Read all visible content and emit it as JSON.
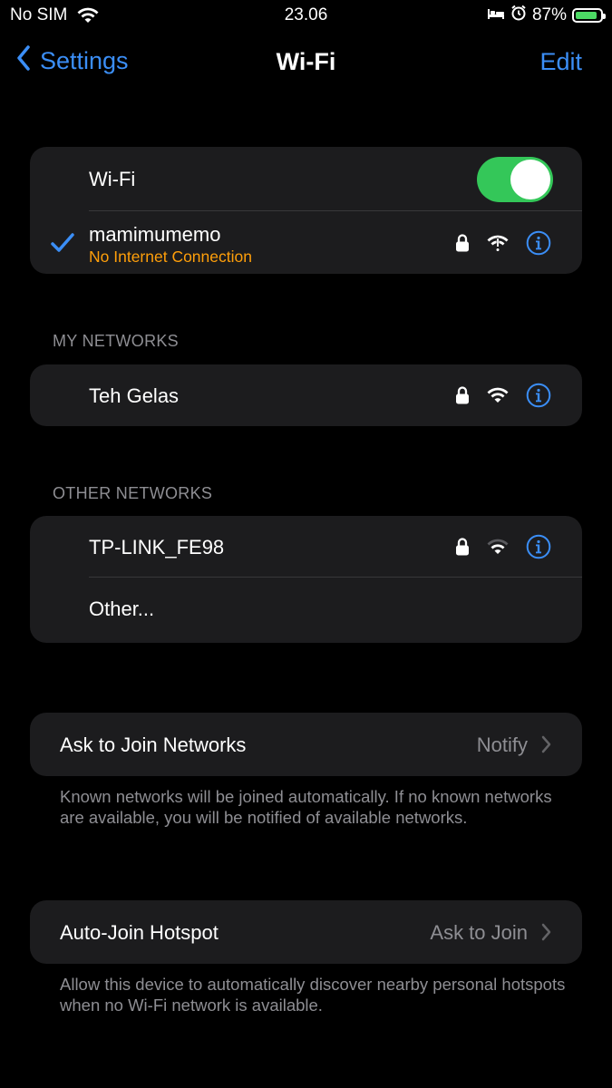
{
  "status_bar": {
    "carrier": "No SIM",
    "time": "23.06",
    "battery": "87%",
    "battery_level": 0.87,
    "battery_color": "#4cd964"
  },
  "nav": {
    "back_label": "Settings",
    "title": "Wi-Fi",
    "edit_label": "Edit"
  },
  "wifi_group": {
    "toggle_label": "Wi-Fi",
    "toggle_on": true,
    "connected_network": {
      "name": "mamimumemo",
      "status": "No Internet Connection",
      "status_color": "#ff9f0a"
    }
  },
  "my_networks": {
    "header": "MY NETWORKS",
    "items": [
      {
        "name": "Teh Gelas"
      }
    ]
  },
  "other_networks": {
    "header": "OTHER NETWORKS",
    "items": [
      {
        "name": "TP-LINK_FE98"
      }
    ],
    "other_label": "Other..."
  },
  "ask_to_join": {
    "label": "Ask to Join Networks",
    "value": "Notify",
    "footer": "Known networks will be joined automatically. If no known networks are available, you will be notified of available networks."
  },
  "auto_join_hotspot": {
    "label": "Auto-Join Hotspot",
    "value": "Ask to Join",
    "footer": "Allow this device to automatically discover nearby personal hotspots when no Wi-Fi network is available."
  },
  "colors": {
    "accent": "#3b8ef6",
    "toggle_on": "#34c759",
    "cell_bg": "#1c1c1e"
  }
}
